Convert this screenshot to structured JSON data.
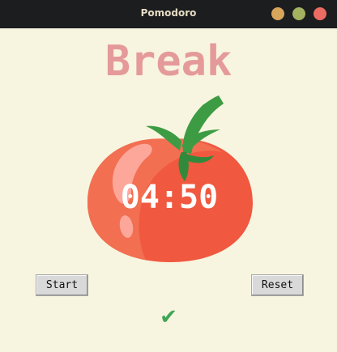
{
  "window": {
    "title": "Pomodoro",
    "controls": {
      "minimize_color": "#d7a65b",
      "maximize_color": "#a3b35f",
      "close_color": "#ec6b63"
    }
  },
  "mode": {
    "label": "Break",
    "color": "#e59a9a"
  },
  "timer": {
    "value": "04:50"
  },
  "buttons": {
    "start_label": "Start",
    "reset_label": "Reset"
  },
  "status": {
    "checkmark": "✔",
    "color": "#3ea556"
  },
  "icons": {
    "tomato": "tomato-icon"
  }
}
